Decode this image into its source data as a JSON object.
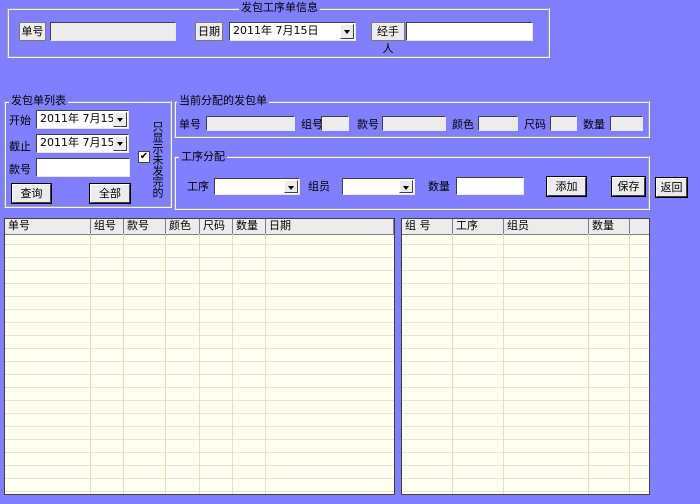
{
  "top_group": {
    "title": "发包工序单信息",
    "order_no_label": "单号",
    "date_label": "日期",
    "date_value": "2011年 7月15日",
    "handler_label": "经手人"
  },
  "list_group": {
    "title": "发包单列表",
    "start_label": "开始",
    "start_value": "2011年 7月15日",
    "end_label": "截止",
    "end_value": "2011年 7月15日",
    "style_label": "款号",
    "only_unsent_label": "只显示未发完的",
    "only_unsent_checked": true,
    "check_mark": "✔",
    "query_button": "查询",
    "all_button": "全部"
  },
  "current_group": {
    "title": "当前分配的发包单",
    "order_no_label": "单号",
    "group_no_label": "组号",
    "style_label": "款号",
    "color_label": "颜色",
    "size_label": "尺码",
    "qty_label": "数量"
  },
  "process_group": {
    "title": "工序分配",
    "process_label": "工序",
    "member_label": "组员",
    "qty_label": "数量",
    "add_button": "添加",
    "save_button": "保存",
    "back_button": "返回"
  },
  "left_grid": {
    "columns": [
      "单号",
      "组号",
      "款号",
      "颜色",
      "尺码",
      "数量",
      "日期"
    ]
  },
  "right_grid": {
    "columns": [
      "组 号",
      "工序",
      "组员",
      "数量"
    ]
  }
}
